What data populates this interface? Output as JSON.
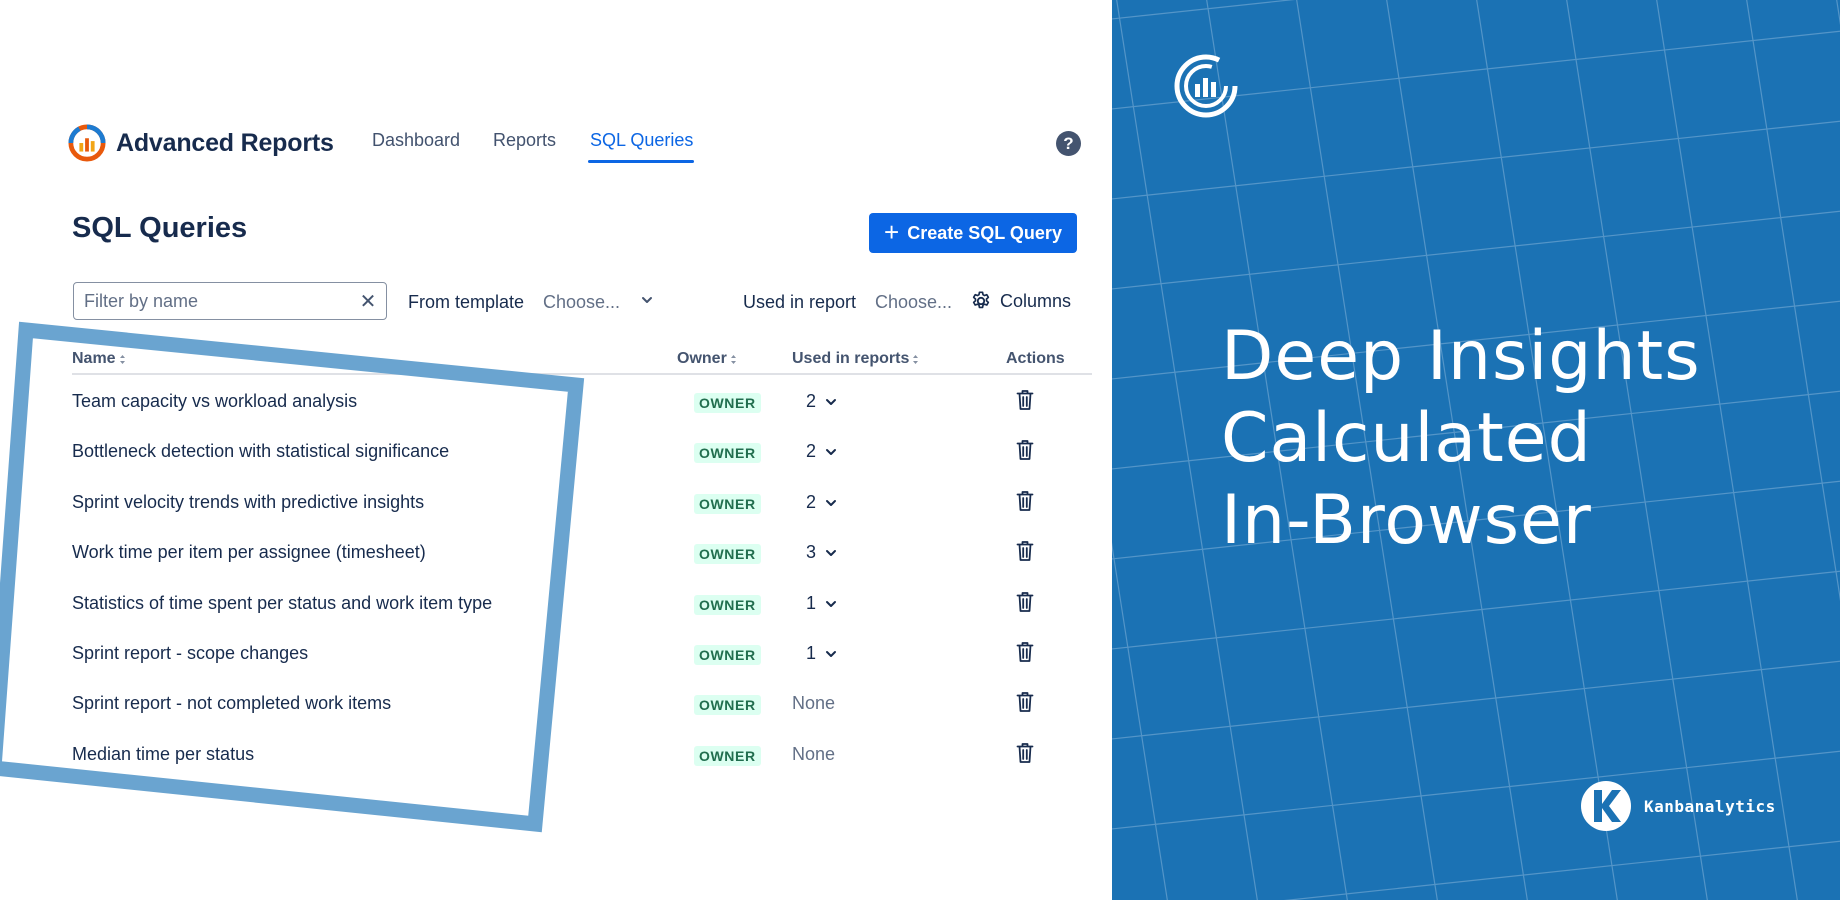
{
  "app": {
    "title": "Advanced Reports",
    "nav": [
      {
        "label": "Dashboard",
        "active": false
      },
      {
        "label": "Reports",
        "active": false
      },
      {
        "label": "SQL Queries",
        "active": true
      }
    ],
    "help_icon": "help-icon"
  },
  "page": {
    "title": "SQL Queries",
    "create_button_label": "Create SQL Query"
  },
  "filters": {
    "name_placeholder": "Filter by name",
    "name_value": "",
    "template_label": "From template",
    "template_value": "Choose...",
    "used_label": "Used in report",
    "used_value": "Choose...",
    "columns_label": "Columns"
  },
  "table": {
    "headers": {
      "name": "Name",
      "owner": "Owner",
      "used": "Used in reports",
      "actions": "Actions"
    },
    "rows": [
      {
        "name": "Team capacity vs workload analysis",
        "owner": "OWNER",
        "used": "2"
      },
      {
        "name": "Bottleneck detection with statistical significance",
        "owner": "OWNER",
        "used": "2"
      },
      {
        "name": "Sprint velocity trends with predictive insights",
        "owner": "OWNER",
        "used": "2"
      },
      {
        "name": "Work time per item per assignee (timesheet)",
        "owner": "OWNER",
        "used": "3"
      },
      {
        "name": "Statistics of time spent per status and work item type",
        "owner": "OWNER",
        "used": "1"
      },
      {
        "name": "Sprint report - scope changes",
        "owner": "OWNER",
        "used": "1"
      },
      {
        "name": "Sprint report - not completed work items",
        "owner": "OWNER",
        "used": "None"
      },
      {
        "name": "Median time per status",
        "owner": "OWNER",
        "used": "None"
      }
    ]
  },
  "promo": {
    "headline": [
      "Deep Insights",
      "Calculated",
      "In-Browser"
    ],
    "brand": "Kanbanalytics",
    "background": "#1b72b4"
  },
  "colors": {
    "accent": "#0c66e4",
    "owner_badge_bg": "#dcfff1",
    "owner_badge_text": "#216e4e",
    "highlight_frame": "#6aa4d0"
  }
}
